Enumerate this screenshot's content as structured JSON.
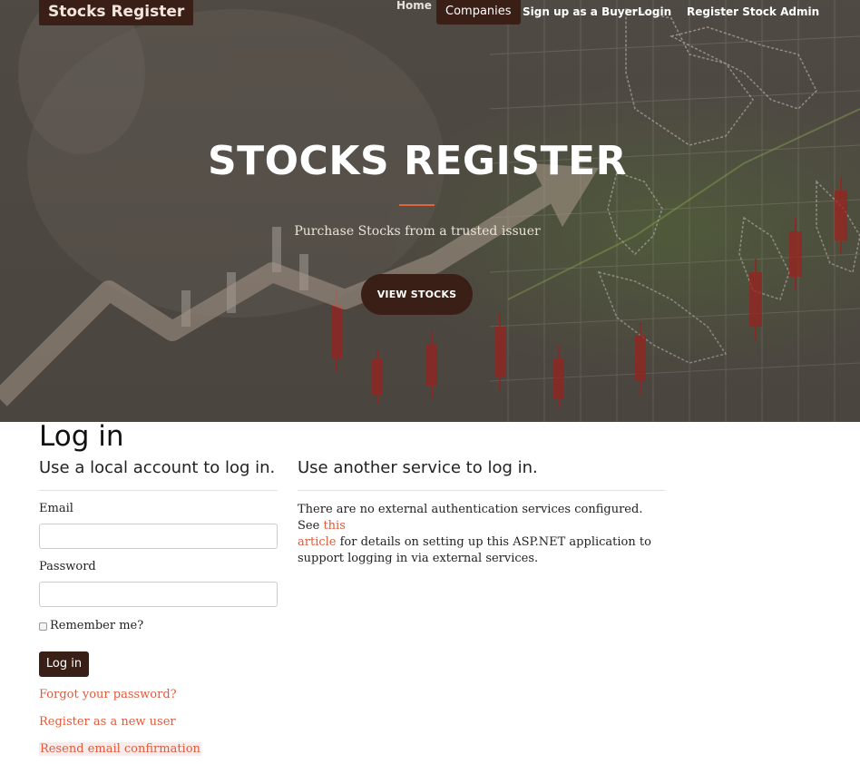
{
  "nav": {
    "brand": "Stocks Register",
    "home": "Home",
    "companies": "Companies",
    "signup_buyer": "Sign up as a Buyer",
    "login": "Login",
    "register_admin": "Register Stock Admin"
  },
  "hero": {
    "title": "STOCKS REGISTER",
    "subtitle": "Purchase Stocks from a trusted issuer",
    "button": "VIEW STOCKS"
  },
  "login": {
    "page_title": "Log in",
    "local_heading": "Use a local account to log in.",
    "email_label": "Email",
    "email_value": "",
    "password_label": "Password",
    "password_value": "",
    "remember_label": "Remember me?",
    "remember_checked": false,
    "submit": "Log in",
    "forgot": "Forgot your password?",
    "register": "Register as a new user",
    "resend": "Resend email confirmation"
  },
  "external": {
    "heading": "Use another service to log in.",
    "text_before": "There are no external authentication services configured. See ",
    "link_text_1": "this",
    "link_text_2": "article",
    "text_after": " for details on setting up this ASP.NET application to support logging in via external services."
  },
  "colors": {
    "brand_dark": "#3a1f17",
    "accent_link": "#e05a3c",
    "hero_rule": "#e0643a"
  }
}
